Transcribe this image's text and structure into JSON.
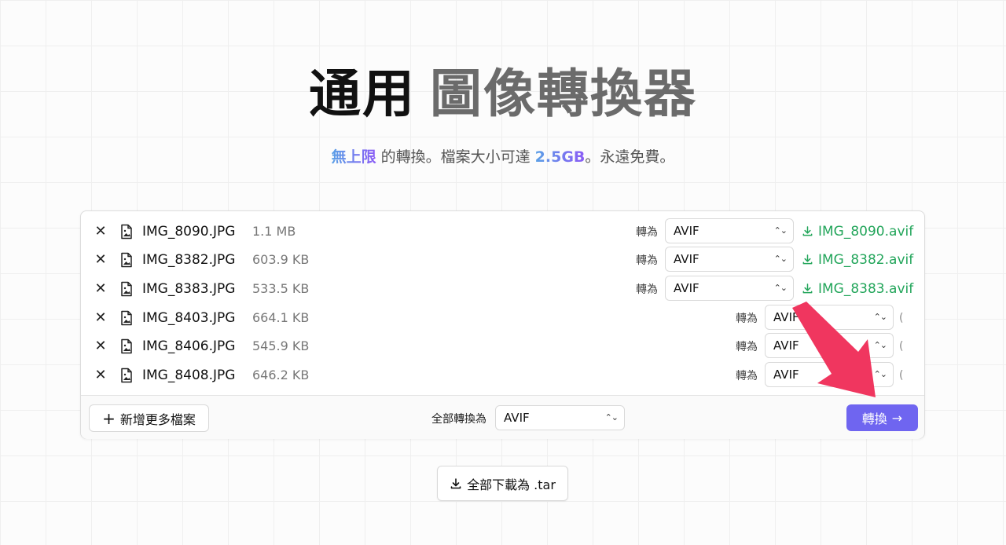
{
  "header": {
    "title_part1": "通用",
    "title_part2": "圖像轉換器",
    "subtitle_highlight1": "無上限",
    "subtitle_text1": " 的轉換。檔案大小可達 ",
    "subtitle_highlight2": "2.5GB",
    "subtitle_text2": "。永遠免費。"
  },
  "files": [
    {
      "name": "IMG_8090.JPG",
      "size": "1.1 MB",
      "to_label": "轉為",
      "format": "AVIF",
      "download": "IMG_8090.avif",
      "status": "done"
    },
    {
      "name": "IMG_8382.JPG",
      "size": "603.9 KB",
      "to_label": "轉為",
      "format": "AVIF",
      "download": "IMG_8382.avif",
      "status": "done"
    },
    {
      "name": "IMG_8383.JPG",
      "size": "533.5 KB",
      "to_label": "轉為",
      "format": "AVIF",
      "download": "IMG_8383.avif",
      "status": "done"
    },
    {
      "name": "IMG_8403.JPG",
      "size": "664.1 KB",
      "to_label": "轉為",
      "format": "AVIF",
      "download": "",
      "status": "loading"
    },
    {
      "name": "IMG_8406.JPG",
      "size": "545.9 KB",
      "to_label": "轉為",
      "format": "AVIF",
      "download": "",
      "status": "loading"
    },
    {
      "name": "IMG_8408.JPG",
      "size": "646.2 KB",
      "to_label": "轉為",
      "format": "AVIF",
      "download": "",
      "status": "loading"
    }
  ],
  "footer": {
    "add_more_label": "新增更多檔案",
    "convert_all_label": "全部轉換為",
    "convert_all_format": "AVIF",
    "convert_button_label": "轉換"
  },
  "download_all_label": "全部下載為 .tar",
  "colors": {
    "accent": "#6f65f0",
    "success": "#22a55a",
    "annotation_arrow": "#f0365f"
  }
}
